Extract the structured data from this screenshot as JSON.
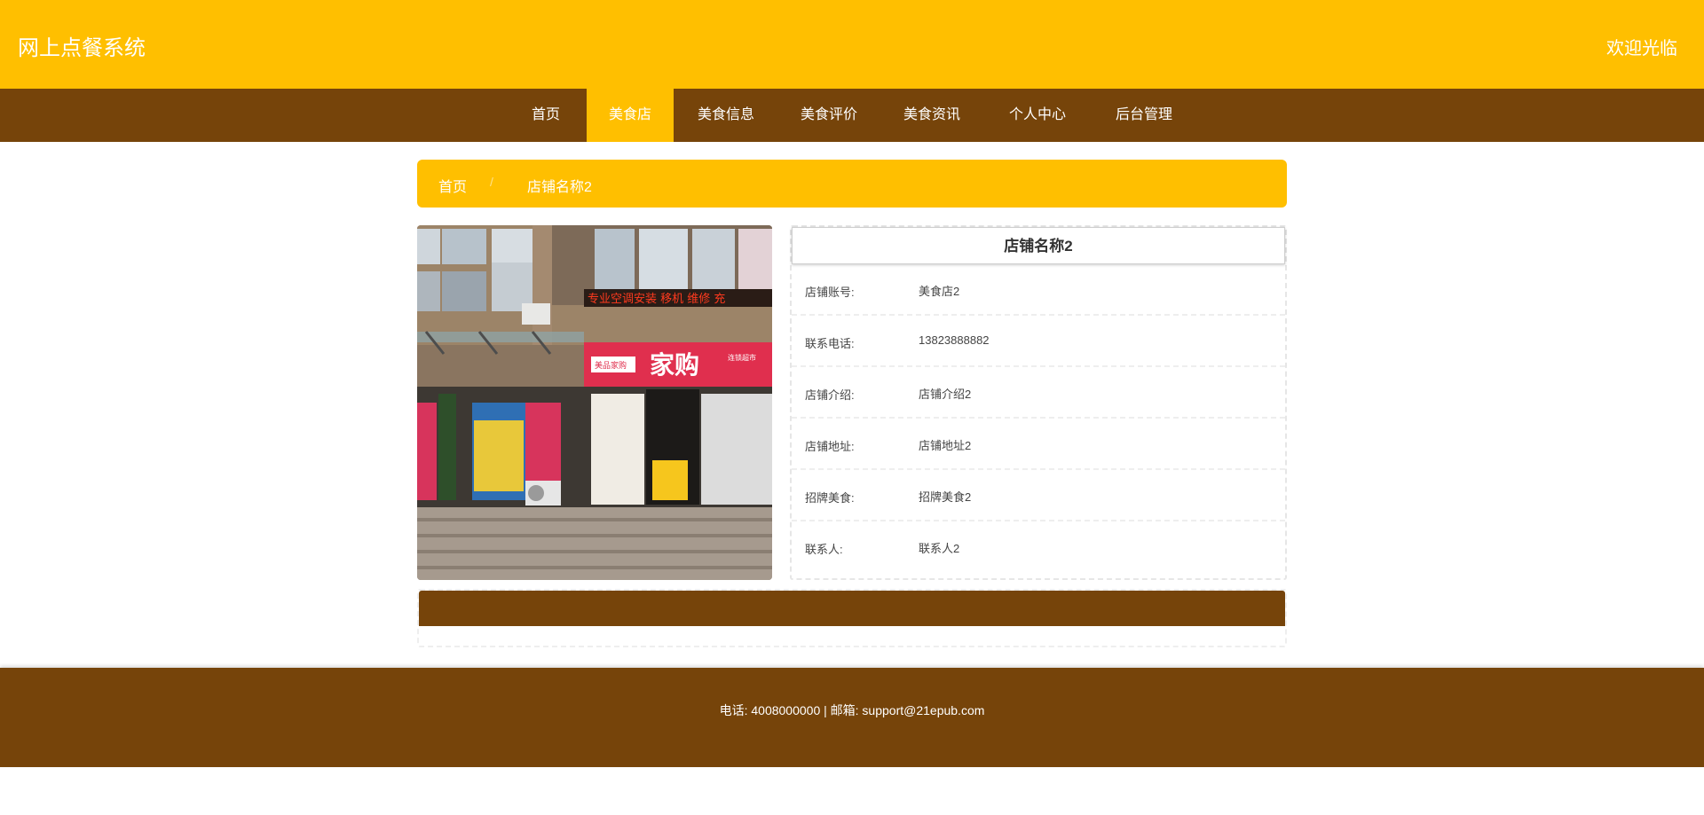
{
  "header": {
    "site_title": "网上点餐系统",
    "welcome": "欢迎光临"
  },
  "nav": {
    "items": [
      {
        "label": "首页",
        "active": false
      },
      {
        "label": "美食店",
        "active": true
      },
      {
        "label": "美食信息",
        "active": false
      },
      {
        "label": "美食评价",
        "active": false
      },
      {
        "label": "美食资讯",
        "active": false
      },
      {
        "label": "个人中心",
        "active": false
      },
      {
        "label": "后台管理",
        "active": false
      }
    ]
  },
  "breadcrumb": {
    "home": "首页",
    "separator": "/",
    "current": "店铺名称2"
  },
  "shop": {
    "title": "店铺名称2",
    "fields": [
      {
        "label": "店铺账号:",
        "value": "美食店2"
      },
      {
        "label": "联系电话:",
        "value": "13823888882"
      },
      {
        "label": "店铺介绍:",
        "value": "店铺介绍2"
      },
      {
        "label": "店铺地址:",
        "value": "店铺地址2"
      },
      {
        "label": "招牌美食:",
        "value": "招牌美食2"
      },
      {
        "label": "联系人:",
        "value": "联系人2"
      }
    ],
    "photo_signs": {
      "led": "专业空调安装 移机 维修 充",
      "store": "家购",
      "badge": "美品家购",
      "side": "连锁超市"
    }
  },
  "footer": {
    "text": "电话: 4008000000 | 邮箱: support@21epub.com"
  },
  "colors": {
    "primary": "#ffbf00",
    "secondary": "#76440a"
  }
}
